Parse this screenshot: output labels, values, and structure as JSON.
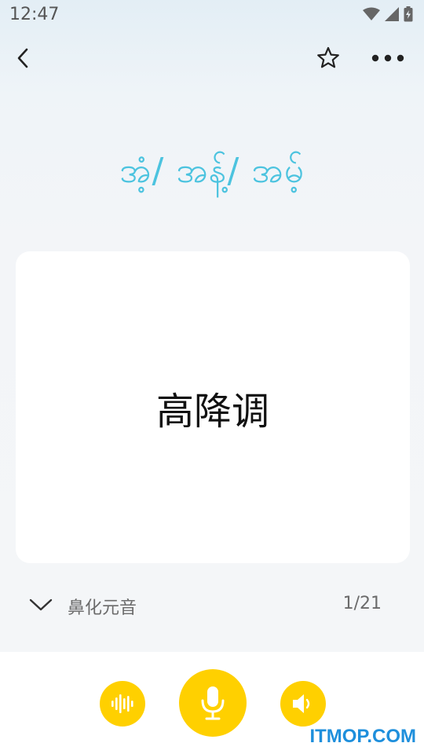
{
  "status_bar": {
    "time": "12:47",
    "icons": [
      "wifi-icon",
      "cell-signal-icon",
      "battery-charging-icon"
    ]
  },
  "top_bar": {
    "icons": [
      "back-chevron-icon",
      "star-outline-icon",
      "more-dots-icon"
    ]
  },
  "heading": {
    "text": "အံ့/ အန့်/ အမ့်"
  },
  "card": {
    "text": "高降调"
  },
  "info_row": {
    "lesson_title": "鼻化元音",
    "page_counter": "1/21"
  },
  "bottom_bar": {
    "icons": [
      "sound-wave-icon",
      "microphone-icon",
      "speaker-icon"
    ]
  },
  "watermark": "ITMOP.COM",
  "colors": {
    "accent": "#4cc3df",
    "button": "#ffd000",
    "watermark": "#1e8fdc"
  }
}
